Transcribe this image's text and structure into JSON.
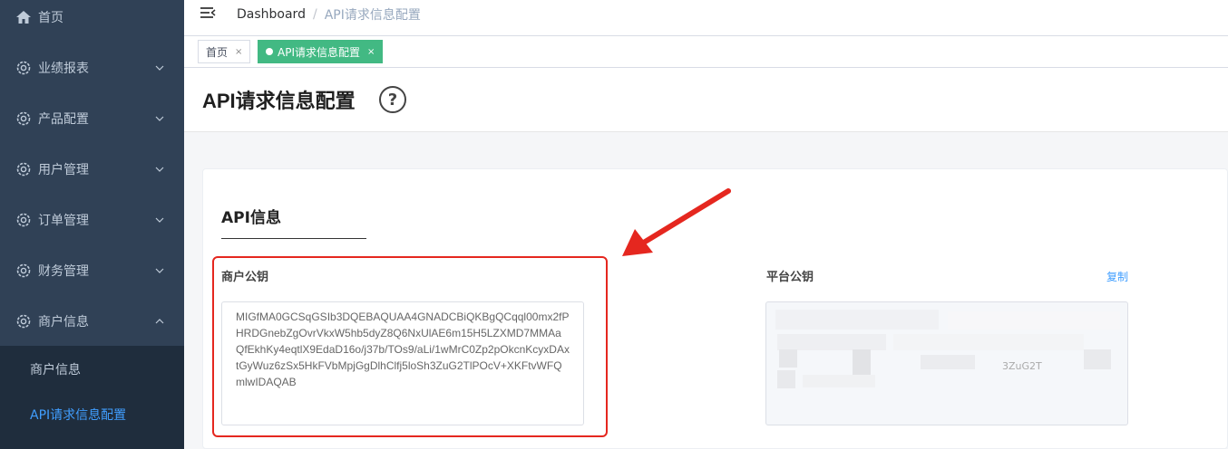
{
  "sidebar": {
    "items": [
      {
        "label": "首页",
        "icon": "home-icon"
      },
      {
        "label": "业绩报表",
        "icon": "gear-icon"
      },
      {
        "label": "产品配置",
        "icon": "gear-icon"
      },
      {
        "label": "用户管理",
        "icon": "gear-icon"
      },
      {
        "label": "订单管理",
        "icon": "gear-icon"
      },
      {
        "label": "财务管理",
        "icon": "gear-icon"
      },
      {
        "label": "商户信息",
        "icon": "gear-icon"
      }
    ],
    "submenu": [
      {
        "label": "商户信息"
      },
      {
        "label": "API请求信息配置"
      }
    ]
  },
  "breadcrumb": {
    "root": "Dashboard",
    "separator": "/",
    "current": "API请求信息配置"
  },
  "tags": [
    {
      "label": "首页",
      "close": "×"
    },
    {
      "label": "API请求信息配置",
      "close": "×"
    }
  ],
  "page": {
    "title": "API请求信息配置",
    "help": "?"
  },
  "section": {
    "title": "API信息",
    "merchant_key_label": "商户公钥",
    "platform_key_label": "平台公钥",
    "copy_label": "复制",
    "merchant_key_value": "MIGfMA0GCSqGSIb3DQEBAQUAA4GNADCBiQKBgQCqql00mx2fPHRDGnebZgOvrVkxW5hb5dyZ8Q6NxUlAE6m15H5LZXMD7MMAaQfEkhKy4eqtlX9EdaD16o/j37b/TOs9/aLi/1wMrC0Zp2pOkcnKcyxDAxtGyWuz6zSx5HkFVbMpjGgDlhClfj5loSh3ZuG2TlPOcV+XKFtvWFQmlwIDAQAB",
    "platform_key_partial": "3ZuG2T"
  },
  "colors": {
    "sidebar_bg": "#304156",
    "submenu_bg": "#1f2d3d",
    "active_link": "#409eff",
    "tag_active": "#42b983",
    "highlight_border": "#e5271f"
  }
}
